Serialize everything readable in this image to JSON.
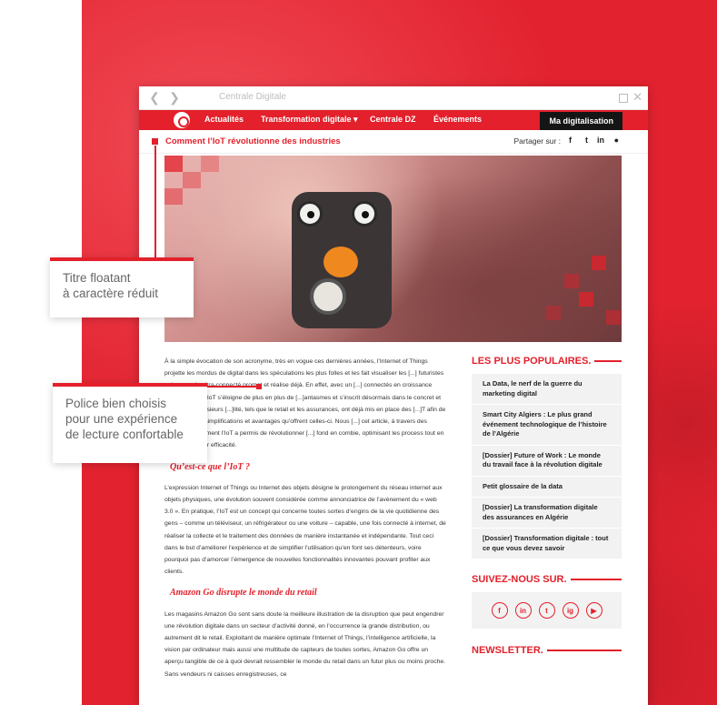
{
  "browser": {
    "tab_title": "Centrale Digitale",
    "back_icon": "chevron-left-icon",
    "forward_icon": "chevron-right-icon"
  },
  "navbar": {
    "items": [
      "Actualités",
      "Transformation digitale ▾",
      "Centrale DZ",
      "Événements"
    ],
    "cta": "Ma digitalisation"
  },
  "subbar": {
    "title": "Comment l’IoT révolutionne des industries",
    "share_label": "Partager sur :",
    "share_icons": [
      "f",
      "t",
      "in",
      "●"
    ]
  },
  "article": {
    "intro": "À la simple évocation de son acronyme, très en vogue ces dernières années, l’Internet of Things projette les mordus de digital dans les spéculations les plus folles et les fait visualiser les [...] futuristes qu’un monde ultra-connecté promet et réalise déjà. En effet, avec un [...] connectés en croissance exponentielle, l’IoT s’éloigne de plus en plus de [...]antasmes et s’inscrit désormais dans le concret et le palpable. Plusieurs [...]lité, tels que le retail et les assurances, ont déjà mis en place des [...]T afin de bénéficier des simplifications et avantages qu’offrent celles-ci. Nous [...] cet article, à travers des exemples, comment l’IoT a permis de révolutionner [...] fond en combie, optimisant les process tout en augmentant leur efficacité.",
    "h1": "Qu’est-ce que l’IoT ?",
    "p1": "L’expression Internet of Things ou Internet des objets désigne le prolongement du réseau internet aux objets physiques, une évolution souvent considérée comme annonciatrice de l’avènement du « web 3.0 ». En pratique, l’IoT est un concept qui concerne toutes sortes d’engins de la vie quotidienne des gens – comme un téléviseur, un réfrigérateur ou une voiture – capable, une fois connecté à internet, de réaliser la collecte et le traitement des données de manière instantanée et indépendante. Tout ceci dans le but d’améliorer l’expérience et de simplifier l’utilisation qu’en font ses détenteurs, voire pourquoi pas d’amorcer l’émergence de nouvelles fonctionnalités innovantes pouvant profiter aux clients.",
    "h2": "Amazon Go disrupte le monde du retail",
    "p2": "Les magasins Amazon Go sont sans doute la meilleure illustration de la disruption que peut engendrer une révolution digitale dans un secteur d’activité donné, en l’occurrence la grande distribution, ou autrement dit le retail. Exploitant de manière optimale l’Internet of Things, l’intelligence artificielle, la vision par ordinateur mais aussi une multitude de capteurs de toutes sortes, Amazon Go offre un aperçu tangible de ce à quoi devrait ressembler le monde du retail dans un futur plus ou moins proche. Sans vendeurs ni caisses enregistreuses, ce"
  },
  "sidebar": {
    "popular_heading": "LES PLUS POPULAIRES.",
    "popular": [
      "La Data, le nerf de la guerre du marketing digital",
      "Smart City Algiers : Le plus grand événement technologique de l’histoire de l’Algérie",
      "[Dossier] Future of Work : Le monde du travail face à la révolution digitale",
      "Petit glossaire de la data",
      "[Dossier] La transformation digitale des assurances en Algérie",
      "[Dossier] Transformation digitale : tout ce que vous devez savoir"
    ],
    "follow_heading": "SUIVEZ-NOUS SUR.",
    "social": [
      "f",
      "in",
      "t",
      "ig",
      "▶"
    ],
    "newsletter_heading": "NEWSLETTER."
  },
  "callouts": {
    "one": "Titre floatant\nà caractère réduit",
    "two": "Police bien choisis\npour une expérience\nde lecture confortable"
  },
  "colors": {
    "accent": "#e3202b",
    "nav_dark": "#151515"
  }
}
